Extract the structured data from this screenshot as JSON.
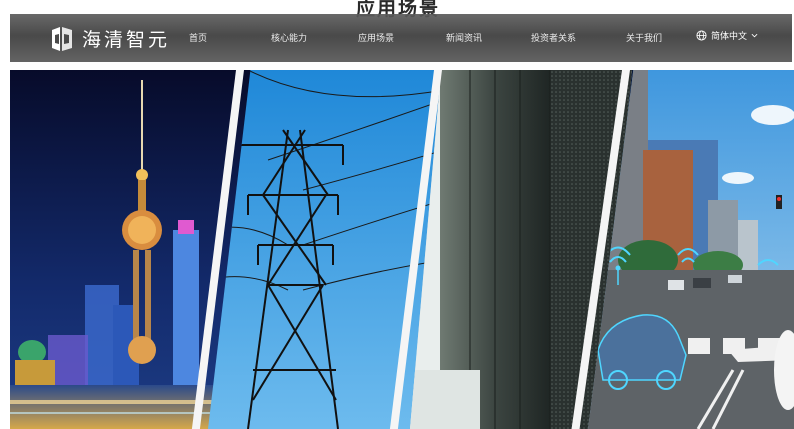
{
  "page": {
    "section_heading": "应用场景"
  },
  "header": {
    "logo_text": "海清智元",
    "logo_icon": "logo-mark-icon",
    "nav_items": [
      {
        "label": "首页"
      },
      {
        "label": "核心能力"
      },
      {
        "label": "应用场景"
      },
      {
        "label": "新闻资讯"
      },
      {
        "label": "投资者关系"
      },
      {
        "label": "关于我们"
      }
    ],
    "language": {
      "icon": "globe-icon",
      "label": "简体中文",
      "chevron": "chevron-down-icon"
    }
  },
  "banner": {
    "panels": [
      {
        "name": "city-skyline"
      },
      {
        "name": "power-tower"
      },
      {
        "name": "server-racks"
      },
      {
        "name": "connected-road"
      }
    ]
  },
  "colors": {
    "nav_bg": "#4a4a4a",
    "nav_text": "#ffffff",
    "sky_night": "#0b1640",
    "sky_day": "#4fa6e0"
  }
}
